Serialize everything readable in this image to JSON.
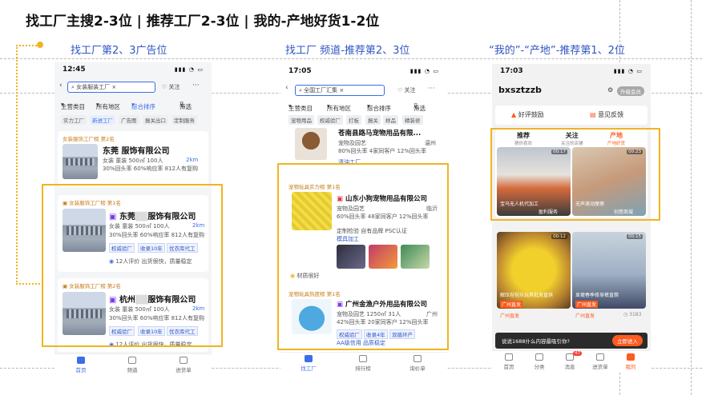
{
  "slide": {
    "title": "找工厂主搜2-3位 | 推荐工厂2-3位 | 我的-产地好货1-2位"
  },
  "columns": [
    {
      "caption": "找工厂第2、3广告位"
    },
    {
      "caption": "找工厂 频道-推荐第2、3位"
    },
    {
      "caption": "“我的”-“产地”-推荐第1、2位"
    }
  ],
  "phone1": {
    "time": "12:45",
    "search_value": "女装服装工厂",
    "follow": "关注",
    "filters": [
      "主营类目",
      "所有地区",
      "综合排序",
      "筛选"
    ],
    "chips": [
      "实力工厂",
      "新进工厂",
      "广告图",
      "报关出口",
      "定制服务"
    ],
    "cards": [
      {
        "tag": "女装服饰工厂榜 第2名",
        "name": "东莞",
        "name_suffix": "服饰有限公司",
        "cat": "女装 童装",
        "area": "500㎡",
        "staff": "100人",
        "rate1": "30%",
        "rate1_label": "回头率",
        "rate2": "60%",
        "rate2_label": "响应率",
        "buyers": "812人有复购",
        "distance": "2km",
        "badges": [
          "权威验厂",
          "收录10年",
          "优衣库代工"
        ],
        "reviews": "12人评价",
        "quick": "出货很快，质量稳定"
      },
      {
        "tag": "女装服饰工厂榜 第1名",
        "name": "东莞",
        "name_suffix": "服饰有限公司",
        "cat": "女装 童装",
        "area": "500㎡",
        "staff": "100人",
        "rate1": "30%",
        "rate1_label": "回头率",
        "rate2": "60%",
        "rate2_label": "响应率",
        "buyers": "812人有复购",
        "distance": "2km",
        "badges": [
          "权威验厂",
          "收录10年",
          "优衣库代工"
        ],
        "reviews": "12人评价",
        "quick": "出货很快，质量稳定"
      },
      {
        "tag": "女装服饰工厂榜 第2名",
        "name": "杭州",
        "name_suffix": "服饰有限公司",
        "cat": "女装 童装",
        "area": "500㎡",
        "staff": "100人",
        "rate1": "30%",
        "rate1_label": "回头率",
        "rate2": "60%",
        "rate2_label": "响应率",
        "buyers": "812人有复购",
        "distance": "2km",
        "badges": [
          "权威验厂",
          "收录10年",
          "优衣库代工"
        ],
        "reviews": "12人评价",
        "quick": "出货很快，质量稳定"
      }
    ],
    "tabs": [
      "首页",
      "频道",
      "进货单"
    ]
  },
  "phone2": {
    "time": "17:05",
    "search_value": "全国工厂汇集",
    "follow": "关注",
    "filters": [
      "主营类目",
      "所有地区",
      "综合排序",
      "筛选"
    ],
    "chips": [
      "宠物用品",
      "权威验厂",
      "打板",
      "报关",
      "样品",
      "精装修"
    ],
    "top_card": {
      "name": "苍南县路马宠物用品有限...",
      "cat": "宠物及园艺",
      "meta": "80%回头率  4家同客户  12%回头率",
      "extra": "清油工厂",
      "region": "温州"
    },
    "cards": [
      {
        "tag": "宠物玩具实力榜 第1名",
        "name": "山东小狗宠物用品有限公司",
        "cat": "宠物及园艺",
        "meta": "60%回头率  48家同客户  12%回头率",
        "region": "临沂",
        "certs": [
          "定制检验",
          "自有品牌",
          "PSC认证"
        ],
        "extra": "模具加工",
        "footer": "材质很好"
      },
      {
        "tag": "宠物玩具热度榜 第1名",
        "name": "广州金渔户外用品有限公司",
        "cat": "宠物及园艺",
        "area": "1250㎡",
        "staff": "31人",
        "region": "广州",
        "meta": "42%回头率  20家同客户  12%回头率",
        "badges": [
          "权威验厂",
          "收录4年",
          "双循环产"
        ],
        "extra": "AA级信用",
        "extra2": "品质稳定"
      }
    ],
    "tabs": [
      "找工厂",
      "排行榜",
      "询价单"
    ]
  },
  "phone3": {
    "time": "17:03",
    "username": "bxsztzzb",
    "vip_badge": "升级会员",
    "actions": [
      "好评鼓励",
      "意见反馈"
    ],
    "tabs_top": [
      {
        "label": "推荐",
        "sub": "猜你喜欢"
      },
      {
        "label": "关注",
        "sub": "关注的店铺"
      },
      {
        "label": "产地",
        "sub": "产地好货"
      }
    ],
    "videos": [
      {
        "caption": "宝马无人机代加工",
        "sub": "盈利服务",
        "duration": "00:17"
      },
      {
        "caption": "无声滚动摩擦",
        "sub": "创意商城",
        "duration": "00:23"
      },
      {
        "caption": "解压捏捏乐玩具批发直供",
        "sub": "广州直发",
        "duration": "00:12"
      },
      {
        "caption": "显瘦春季修身裤直筒",
        "sub": "广州直发",
        "duration": "00:15"
      }
    ],
    "product_badges": [
      "广州直发",
      "广州直发",
      "广州直发",
      "广州直发"
    ],
    "view_count": "3183",
    "toast": "说说1688什么内容最吸引你?",
    "toast_btn": "立即进入",
    "bottom_tabs": [
      "首页",
      "分类",
      "消息",
      "进货单",
      "我的"
    ],
    "msg_count": "47"
  }
}
